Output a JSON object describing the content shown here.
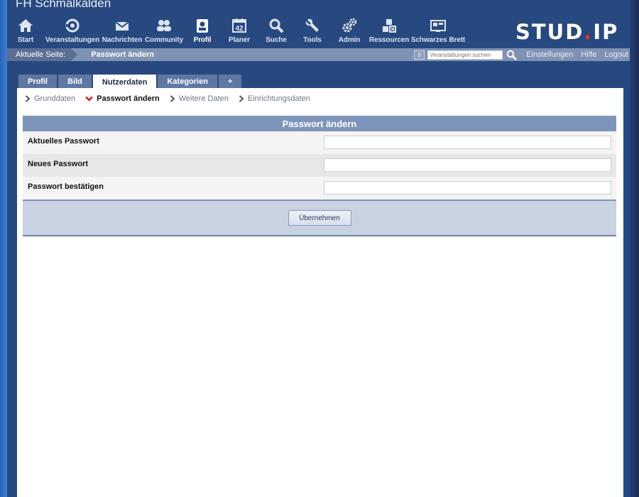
{
  "site": {
    "title": "FH Schmalkalden"
  },
  "nav": [
    {
      "label": "Start",
      "icon": "home-icon"
    },
    {
      "label": "Veranstaltungen",
      "icon": "courses-icon"
    },
    {
      "label": "Nachrichten",
      "icon": "mail-icon"
    },
    {
      "label": "Community",
      "icon": "community-icon"
    },
    {
      "label": "Profil",
      "icon": "profile-icon",
      "active": true
    },
    {
      "label": "Planer",
      "icon": "calendar-icon",
      "calendar_day": "42"
    },
    {
      "label": "Suche",
      "icon": "search-icon"
    },
    {
      "label": "Tools",
      "icon": "wrench-icon"
    },
    {
      "label": "Admin",
      "icon": "gears-icon"
    },
    {
      "label": "Ressourcen",
      "icon": "resources-icon"
    },
    {
      "label": "Schwarzes Brett",
      "icon": "board-icon"
    }
  ],
  "logo": {
    "text_main": "STUD",
    "text_dot": ".",
    "text_end": "IP",
    "dot_color": "#e53333"
  },
  "breadcrumb": {
    "label": "Aktuelle Seite:",
    "current": "Passwort ändern"
  },
  "topbar": {
    "course_count": "0",
    "search_placeholder": "Veranstaltungen suchen",
    "links": [
      "Einstellungen",
      "Hilfe",
      "Logout"
    ]
  },
  "tabs": [
    {
      "label": "Profil"
    },
    {
      "label": "Bild"
    },
    {
      "label": "Nutzerdaten",
      "active": true
    },
    {
      "label": "Kategorien"
    },
    {
      "label": "+"
    }
  ],
  "subnav": [
    {
      "label": "Grunddaten"
    },
    {
      "label": "Passwort ändern",
      "active": true
    },
    {
      "label": "Weitere Daten"
    },
    {
      "label": "Einrichtungsdaten"
    }
  ],
  "form": {
    "title": "Passwort ändern",
    "fields": [
      {
        "label": "Aktuelles Passwort",
        "value": ""
      },
      {
        "label": "Neues Passwort",
        "value": ""
      },
      {
        "label": "Passwort bestätigen",
        "value": ""
      }
    ],
    "submit_label": "Übernehmen"
  },
  "colors": {
    "header_bg": "#28497f",
    "crumbbar_bg": "#7f92b3",
    "form_head_bg": "#7f94bb",
    "accent_red": "#cc2222"
  }
}
